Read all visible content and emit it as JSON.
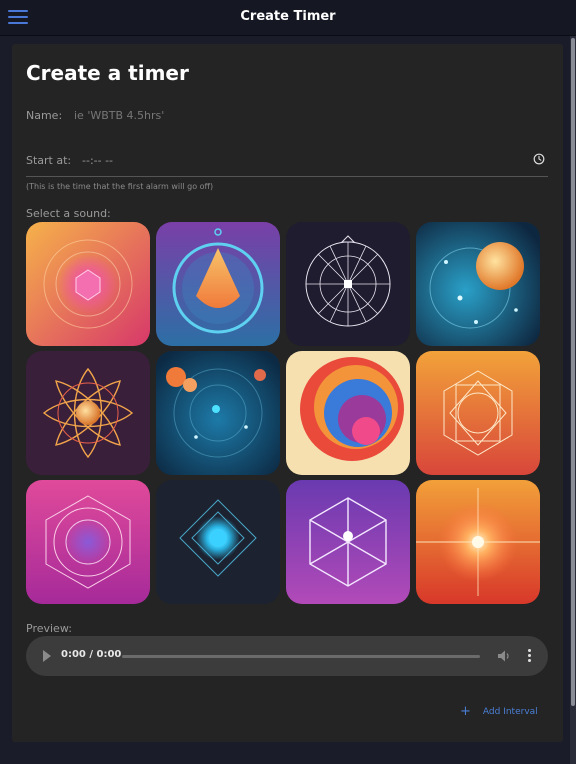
{
  "app": {
    "title": "Create Timer"
  },
  "form": {
    "heading": "Create a timer",
    "name_label": "Name:",
    "name_placeholder": "ie 'WBTB 4.5hrs'",
    "name_value": "",
    "start_label": "Start at:",
    "start_value": "--:-- --",
    "start_hint": "(This is the time that the first alarm will go off)",
    "sound_label": "Select a sound:",
    "sounds": [
      {
        "icon": "orange-crystal-orb-icon"
      },
      {
        "icon": "blue-ring-flame-icon"
      },
      {
        "icon": "line-compass-icon"
      },
      {
        "icon": "cosmic-sphere-icon"
      },
      {
        "icon": "orange-lotus-sun-icon"
      },
      {
        "icon": "blue-planets-icon"
      },
      {
        "icon": "swirl-circles-icon"
      },
      {
        "icon": "golden-mandala-icon"
      },
      {
        "icon": "pink-crystal-mandala-icon"
      },
      {
        "icon": "blue-energy-diamond-icon"
      },
      {
        "icon": "violet-hexagon-prism-icon"
      },
      {
        "icon": "sunburst-glow-icon"
      }
    ],
    "preview_label": "Preview:",
    "player": {
      "time": "0:00 / 0:00",
      "progress": 0
    },
    "add_interval_label": "Add Interval"
  },
  "colors": {
    "accent": "#4a7fd6",
    "card_bg": "#242424",
    "page_bg": "#1a1c29"
  }
}
